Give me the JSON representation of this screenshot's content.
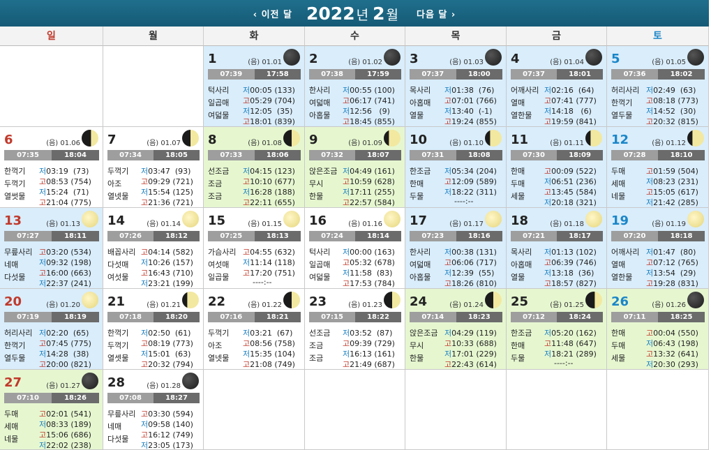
{
  "header": {
    "prev": "‹ 이전 달",
    "year": "2022",
    "year_unit": "년",
    "month": "2",
    "month_unit": "월",
    "next": "다음 달 ›"
  },
  "weekdays": [
    "일",
    "월",
    "화",
    "수",
    "목",
    "금",
    "토"
  ],
  "colors": {
    "moon_dark": "#2b2b2b",
    "moon_bright": "#f2e8a0",
    "header": "#1a6584",
    "sunday": "#c0392b",
    "saturday": "#1a86c8"
  },
  "days": [
    {
      "day": "1",
      "lunar": "(음) 01.01",
      "moon": "dark",
      "rise": "07:39",
      "set": "17:58",
      "mul": [
        "턱사리",
        "일곱매",
        "여덟물"
      ],
      "tides": [
        "저00:05 (133)",
        "고05:29 (704)",
        "저12:05  (35)",
        "고18:01 (839)"
      ]
    },
    {
      "day": "2",
      "lunar": "(음) 01.02",
      "moon": "dark",
      "rise": "07:38",
      "set": "17:59",
      "mul": [
        "한사리",
        "여덟매",
        "아홉물"
      ],
      "tides": [
        "저00:55 (100)",
        "고06:17 (741)",
        "저12:56   (9)",
        "고18:45 (855)"
      ]
    },
    {
      "day": "3",
      "lunar": "(음) 01.03",
      "moon": "dark",
      "rise": "07:37",
      "set": "18:00",
      "mul": [
        "목사리",
        "아홉매",
        "열물"
      ],
      "tides": [
        "저01:38  (76)",
        "고07:01 (766)",
        "저13:40  (-1)",
        "고19:24 (855)"
      ]
    },
    {
      "day": "4",
      "lunar": "(음) 01.04",
      "moon": "dark",
      "rise": "07:37",
      "set": "18:01",
      "mul": [
        "어깨사리",
        "열매",
        "열한물"
      ],
      "tides": [
        "저02:16  (64)",
        "고07:41 (777)",
        "저14:18   (6)",
        "고19:59 (841)"
      ]
    },
    {
      "day": "5",
      "lunar": "(음) 01.05",
      "moon": "dark",
      "rise": "07:36",
      "set": "18:02",
      "mul": [
        "허리사리",
        "한꺽기",
        "열두물"
      ],
      "tides": [
        "저02:49  (63)",
        "고08:18 (773)",
        "저14:52  (30)",
        "고20:32 (815)"
      ]
    },
    {
      "day": "6",
      "lunar": "(음) 01.06",
      "moon": "crescent",
      "rise": "07:35",
      "set": "18:04",
      "mul": [
        "한꺽기",
        "두꺽기",
        "열썻물"
      ],
      "tides": [
        "저03:19  (73)",
        "고08:53 (754)",
        "저15:24  (71)",
        "고21:04 (775)"
      ]
    },
    {
      "day": "7",
      "lunar": "(음) 01.07",
      "moon": "half",
      "rise": "07:34",
      "set": "18:05",
      "mul": [
        "두꺽기",
        "아조",
        "열넷물"
      ],
      "tides": [
        "저03:47  (93)",
        "고09:29 (721)",
        "저15:54 (125)",
        "고21:36 (721)"
      ]
    },
    {
      "day": "8",
      "lunar": "(음) 01.08",
      "moon": "half",
      "rise": "07:33",
      "set": "18:06",
      "mul": [
        "선조금",
        "조금",
        "조금"
      ],
      "tides": [
        "저04:15 (123)",
        "고10:10 (677)",
        "저16:28 (188)",
        "고22:11 (655)"
      ]
    },
    {
      "day": "9",
      "lunar": "(음) 01.09",
      "moon": "gibbous",
      "rise": "07:32",
      "set": "18:07",
      "mul": [
        "앉은조금",
        "무시",
        "한물"
      ],
      "tides": [
        "저04:49 (161)",
        "고10:59 (628)",
        "저17:11 (255)",
        "고22:57 (584)"
      ]
    },
    {
      "day": "10",
      "lunar": "(음) 01.10",
      "moon": "gibbous",
      "rise": "07:31",
      "set": "18:08",
      "mul": [
        "한조금",
        "한매",
        "두물"
      ],
      "tides": [
        "저05:34 (204)",
        "고12:09 (589)",
        "저18:22 (311)",
        "    ----:--"
      ]
    },
    {
      "day": "11",
      "lunar": "(음) 01.11",
      "moon": "gibbous",
      "rise": "07:30",
      "set": "18:09",
      "mul": [
        "한매",
        "두매",
        "세물"
      ],
      "tides": [
        "고00:09 (522)",
        "저06:51 (236)",
        "고13:45 (584)",
        "저20:18 (321)"
      ]
    },
    {
      "day": "12",
      "lunar": "(음) 01.12",
      "moon": "gibbous",
      "rise": "07:28",
      "set": "18:10",
      "mul": [
        "두매",
        "세매",
        "네물"
      ],
      "tides": [
        "고01:59 (504)",
        "저08:23 (231)",
        "고15:05 (617)",
        "저21:42 (285)"
      ]
    },
    {
      "day": "13",
      "lunar": "(음) 01.13",
      "moon": "full",
      "rise": "07:27",
      "set": "18:11",
      "mul": [
        "무릎사리",
        "네매",
        "다섯물"
      ],
      "tides": [
        "고03:20 (534)",
        "저09:32 (198)",
        "고16:00 (663)",
        "저22:37 (241)"
      ]
    },
    {
      "day": "14",
      "lunar": "(음) 01.14",
      "moon": "full",
      "rise": "07:26",
      "set": "18:12",
      "mul": [
        "배꼽사리",
        "다섯매",
        "여섯물"
      ],
      "tides": [
        "고04:14 (582)",
        "저10:26 (157)",
        "고16:43 (710)",
        "저23:21 (199)"
      ]
    },
    {
      "day": "15",
      "lunar": "(음) 01.15",
      "moon": "full",
      "rise": "07:25",
      "set": "18:13",
      "mul": [
        "가슴사리",
        "여섯매",
        "일곱물"
      ],
      "tides": [
        "고04:55 (632)",
        "저11:14 (118)",
        "고17:20 (751)",
        "    ----:--"
      ]
    },
    {
      "day": "16",
      "lunar": "(음) 01.16",
      "moon": "full",
      "rise": "07:24",
      "set": "18:14",
      "mul": [
        "턱사리",
        "일곱매",
        "여덟물"
      ],
      "tides": [
        "저00:00 (163)",
        "고05:32 (678)",
        "저11:58  (83)",
        "고17:53 (784)"
      ]
    },
    {
      "day": "17",
      "lunar": "(음) 01.17",
      "moon": "full",
      "rise": "07:23",
      "set": "18:16",
      "mul": [
        "한사리",
        "여덟매",
        "아홉물"
      ],
      "tides": [
        "저00:38 (131)",
        "고06:06 (717)",
        "저12:39  (55)",
        "고18:26 (810)"
      ]
    },
    {
      "day": "18",
      "lunar": "(음) 01.18",
      "moon": "full",
      "rise": "07:21",
      "set": "18:17",
      "mul": [
        "목사리",
        "아홉매",
        "열물"
      ],
      "tides": [
        "저01:13 (102)",
        "고06:39 (746)",
        "저13:18  (36)",
        "고18:57 (827)"
      ]
    },
    {
      "day": "19",
      "lunar": "(음) 01.19",
      "moon": "full",
      "rise": "07:20",
      "set": "18:18",
      "mul": [
        "어깨사리",
        "열매",
        "열한물"
      ],
      "tides": [
        "저01:47  (80)",
        "고07:12 (765)",
        "저13:54  (29)",
        "고19:28 (831)"
      ]
    },
    {
      "day": "20",
      "lunar": "(음) 01.20",
      "moon": "full",
      "rise": "07:19",
      "set": "18:19",
      "mul": [
        "허리사리",
        "한꺽기",
        "열두물"
      ],
      "tides": [
        "저02:20  (65)",
        "고07:45 (775)",
        "저14:28  (38)",
        "고20:00 (821)"
      ]
    },
    {
      "day": "21",
      "lunar": "(음) 01.21",
      "moon": "gibbous",
      "rise": "07:18",
      "set": "18:20",
      "mul": [
        "한꺽기",
        "두꺽기",
        "열셋물"
      ],
      "tides": [
        "저02:50  (61)",
        "고08:19 (773)",
        "저15:01  (63)",
        "고20:32 (794)"
      ]
    },
    {
      "day": "22",
      "lunar": "(음) 01.22",
      "moon": "half",
      "rise": "07:16",
      "set": "18:21",
      "mul": [
        "두꺽기",
        "아조",
        "열넷물"
      ],
      "tides": [
        "저03:21  (67)",
        "고08:56 (758)",
        "저15:35 (104)",
        "고21:08 (749)"
      ]
    },
    {
      "day": "23",
      "lunar": "(음) 01.23",
      "moon": "half",
      "rise": "07:15",
      "set": "18:22",
      "mul": [
        "선조금",
        "조금",
        "조금"
      ],
      "tides": [
        "저03:52  (87)",
        "고09:39 (729)",
        "저16:13 (161)",
        "고21:49 (687)"
      ]
    },
    {
      "day": "24",
      "lunar": "(음) 01.24",
      "moon": "half",
      "rise": "07:14",
      "set": "18:23",
      "mul": [
        "앉은조금",
        "무시",
        "한물"
      ],
      "tides": [
        "저04:29 (119)",
        "고10:33 (688)",
        "저17:01 (229)",
        "고22:43 (614)"
      ]
    },
    {
      "day": "25",
      "lunar": "(음) 01.25",
      "moon": "crescent",
      "rise": "07:12",
      "set": "18:24",
      "mul": [
        "한조금",
        "한매",
        "두물"
      ],
      "tides": [
        "저05:20 (162)",
        "고11:48 (647)",
        "저18:21 (289)",
        "    ----:--"
      ]
    },
    {
      "day": "26",
      "lunar": "(음) 01.26",
      "moon": "dark",
      "rise": "07:11",
      "set": "18:25",
      "mul": [
        "한매",
        "두매",
        "세물"
      ],
      "tides": [
        "고00:04 (550)",
        "저06:43 (198)",
        "고13:32 (641)",
        "저20:30 (293)"
      ]
    },
    {
      "day": "27",
      "lunar": "(음) 01.27",
      "moon": "dark",
      "rise": "07:10",
      "set": "18:26",
      "mul": [
        "두매",
        "세매",
        "네물"
      ],
      "tides": [
        "고02:01 (541)",
        "저08:33 (189)",
        "고15:06 (686)",
        "저22:02 (238)"
      ]
    },
    {
      "day": "28",
      "lunar": "(음) 01.28",
      "moon": "dark",
      "rise": "07:08",
      "set": "18:27",
      "mul": [
        "무릎사리",
        "네매",
        "다섯물"
      ],
      "tides": [
        "고03:30 (594)",
        "저09:58 (140)",
        "고16:12 (749)",
        "저23:05 (173)"
      ]
    }
  ]
}
